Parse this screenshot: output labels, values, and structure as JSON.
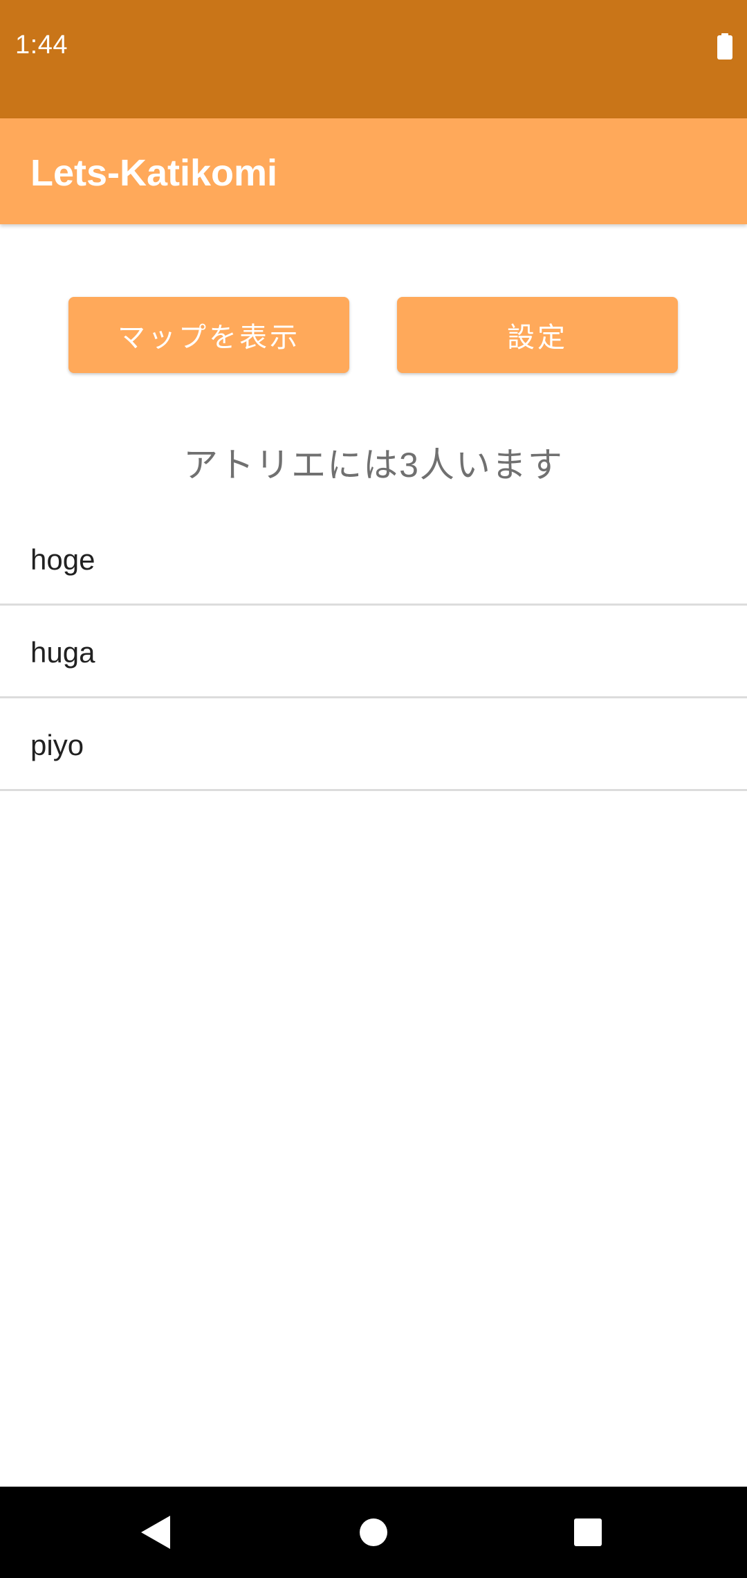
{
  "status_bar": {
    "time": "1:44",
    "battery_icon": "battery-full-icon",
    "background_color": "#c97518"
  },
  "app_bar": {
    "title": "Lets-Katikomi",
    "background_color": "#ffa95a"
  },
  "actions": {
    "map_button_label": "マップを表示",
    "settings_button_label": "設定"
  },
  "summary_text": "アトリエには3人います",
  "members": [
    {
      "name": "hoge"
    },
    {
      "name": "huga"
    },
    {
      "name": "piyo"
    }
  ],
  "nav_bar": {
    "back_icon": "back-triangle-icon",
    "home_icon": "home-circle-icon",
    "recents_icon": "recents-square-icon"
  }
}
